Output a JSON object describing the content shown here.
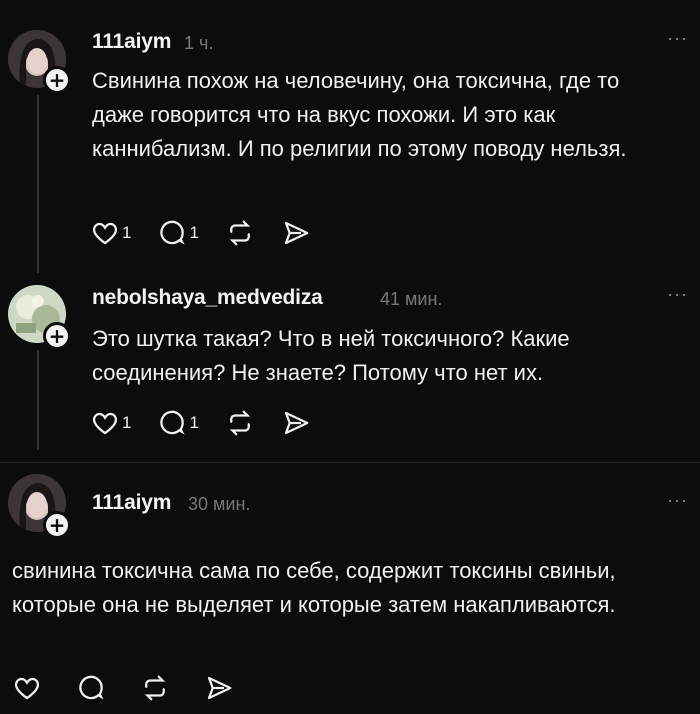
{
  "posts": [
    {
      "user": "111aiym",
      "time": "1 ч.",
      "text": "Свинина похож на человечину, она токсична, где то даже говорится что на вкус похожи. И это как каннибализм. И по религии по этому поводу нельзя.",
      "likes": "1",
      "replies": "1"
    },
    {
      "user": "nebolshaya_medvediza",
      "time": "41 мин.",
      "text": "Это шутка такая? Что в ней токсичного? Какие соединения? Не знаете? Потому что нет их.",
      "likes": "1",
      "replies": "1"
    },
    {
      "user": "111aiym",
      "time": "30 мин.",
      "text": "свинина токсична сама по себе, содержит токсины свиньи, которые она не выделяет и которые затем накапливаются."
    }
  ],
  "more_glyph": "···",
  "plus_glyph": "+",
  "icons": [
    "heart-icon",
    "comment-icon",
    "repost-icon",
    "share-icon"
  ]
}
